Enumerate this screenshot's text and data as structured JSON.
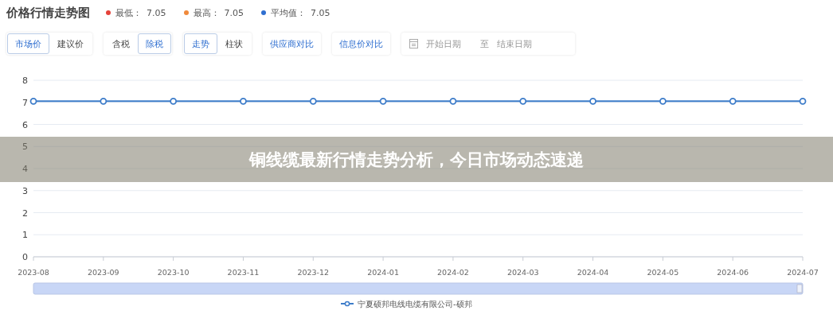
{
  "header": {
    "title": "价格行情走势图",
    "stats": [
      {
        "label": "最低：",
        "value": "7.05",
        "color": "#e5423a"
      },
      {
        "label": "最高：",
        "value": "7.05",
        "color": "#f08a3c"
      },
      {
        "label": "平均值：",
        "value": "7.05",
        "color": "#2f6fd0"
      }
    ]
  },
  "toolbar": {
    "groups": [
      {
        "kind": "segmented",
        "options": [
          {
            "label": "市场价",
            "selected": true
          },
          {
            "label": "建议价",
            "selected": false
          }
        ]
      },
      {
        "kind": "segmented",
        "options": [
          {
            "label": "含税",
            "selected": false
          },
          {
            "label": "除税",
            "selected": true
          }
        ]
      },
      {
        "kind": "segmented",
        "options": [
          {
            "label": "走势",
            "selected": true
          },
          {
            "label": "柱状",
            "selected": false
          }
        ]
      },
      {
        "kind": "button",
        "label": "供应商对比"
      },
      {
        "kind": "button",
        "label": "信息价对比"
      }
    ],
    "date_range": {
      "start_placeholder": "开始日期",
      "separator": "至",
      "end_placeholder": "结束日期"
    }
  },
  "chart": {
    "chart_data": {
      "type": "line",
      "categories": [
        "2023-08",
        "2023-09",
        "2023-10",
        "2023-11",
        "2023-12",
        "2024-01",
        "2024-02",
        "2024-03",
        "2024-04",
        "2024-05",
        "2024-06",
        "2024-07"
      ],
      "series": [
        {
          "name": "宁夏硕邦电线电缆有限公司-硕邦",
          "color": "#3d7cc9",
          "marker": true,
          "values": [
            7.05,
            7.05,
            7.05,
            7.05,
            7.05,
            7.05,
            7.05,
            7.05,
            7.05,
            7.05,
            7.05,
            7.05
          ]
        }
      ],
      "grid": true,
      "ylim": [
        0,
        8
      ],
      "yticks": [
        0,
        1,
        2,
        3,
        4,
        5,
        6,
        7,
        8
      ]
    }
  },
  "banner": {
    "text": "铜线缆最新行情走势分析，今日市场动态速递"
  }
}
